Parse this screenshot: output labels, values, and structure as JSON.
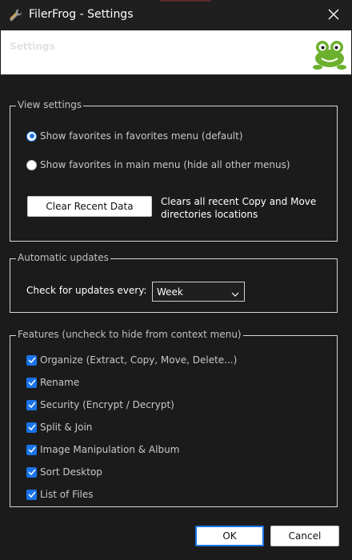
{
  "window": {
    "title": "FilerFrog - Settings",
    "close_icon": "close-icon",
    "app_icon": "wrench-icon"
  },
  "header": {
    "title": "Settings",
    "logo_icon": "frog-logo"
  },
  "view_settings": {
    "legend": "View settings",
    "radio_favorites_menu": "Show favorites in favorites menu (default)",
    "radio_main_menu": "Show favorites in main menu (hide all other menus)",
    "selected": "favorites_menu",
    "clear_button": "Clear Recent Data",
    "clear_description": "Clears all recent Copy and Move directories locations"
  },
  "automatic_updates": {
    "legend": "Automatic updates",
    "label": "Check for updates every:",
    "selected_option": "Week"
  },
  "features": {
    "legend": "Features (uncheck to hide from context menu)",
    "items": [
      {
        "label": "Organize (Extract, Copy, Move, Delete...)",
        "checked": true
      },
      {
        "label": "Rename",
        "checked": true
      },
      {
        "label": "Security (Encrypt / Decrypt)",
        "checked": true
      },
      {
        "label": "Split & Join",
        "checked": true
      },
      {
        "label": "Image Manipulation & Album",
        "checked": true
      },
      {
        "label": "Sort Desktop",
        "checked": true
      },
      {
        "label": "List of Files",
        "checked": true
      }
    ]
  },
  "buttons": {
    "ok": "OK",
    "cancel": "Cancel"
  },
  "colors": {
    "accent": "#1a73e8",
    "background": "#1b1b1b",
    "frog_green": "#6cb02d"
  }
}
